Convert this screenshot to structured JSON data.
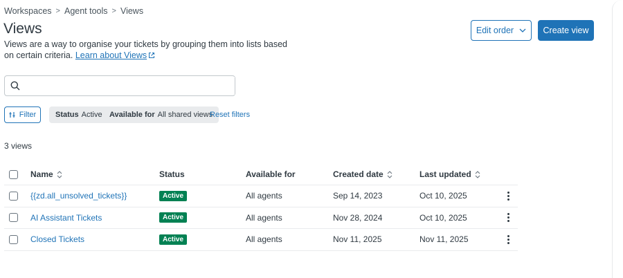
{
  "breadcrumb": {
    "items": [
      "Workspaces",
      "Agent tools",
      "Views"
    ],
    "separator": ">"
  },
  "page": {
    "title": "Views",
    "description": "Views are a way to organise your tickets by grouping them into lists based on certain criteria.",
    "learn_link": "Learn about Views"
  },
  "actions": {
    "edit_order": "Edit order",
    "create_view": "Create view"
  },
  "search": {
    "value": "",
    "placeholder": ""
  },
  "filters": {
    "filter_label": "Filter",
    "status_key": "Status",
    "status_value": "Active",
    "available_key": "Available for",
    "available_value": "All shared views",
    "reset_label": "Reset filters"
  },
  "views_count": "3 views",
  "table": {
    "columns": {
      "name": "Name",
      "status": "Status",
      "available": "Available for",
      "created": "Created date",
      "updated": "Last updated"
    },
    "rows": [
      {
        "name": "{{zd.all_unsolved_tickets}}",
        "status": "Active",
        "available": "All agents",
        "created": "Sep 14, 2023",
        "updated": "Oct 10, 2025"
      },
      {
        "name": "AI Assistant Tickets",
        "status": "Active",
        "available": "All agents",
        "created": "Nov 28, 2024",
        "updated": "Oct 10, 2025"
      },
      {
        "name": "Closed Tickets",
        "status": "Active",
        "available": "All agents",
        "created": "Nov 11, 2025",
        "updated": "Nov 11, 2025"
      }
    ]
  },
  "colors": {
    "primary": "#1f73b7",
    "active_badge": "#038153",
    "chip_bg": "#e9ebed",
    "text": "#2f3941"
  },
  "icons": [
    "chevron-right-icon",
    "external-link-icon",
    "chevron-down-icon",
    "search-icon",
    "filter-sliders-icon",
    "sort-icon",
    "kebab-menu-icon"
  ]
}
